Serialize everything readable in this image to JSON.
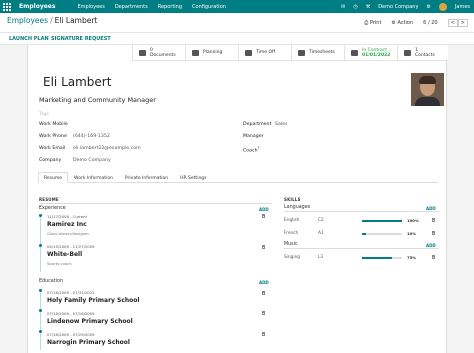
{
  "topbar": {
    "app_name": "Employees",
    "menu": [
      "Employees",
      "Departments",
      "Reporting",
      "Configuration"
    ],
    "company": "Demo Company",
    "user": "James"
  },
  "breadcrumb": {
    "parent": "Employees",
    "separator": "/",
    "current": "Eli Lambert"
  },
  "toolbar": {
    "print": "Print",
    "action": "Action",
    "pager": "6 / 20",
    "prev": "<",
    "next": ">"
  },
  "actions": {
    "launch_plan": "LAUNCH PLAN",
    "signature_request": "SIGNATURE REQUEST"
  },
  "smart_buttons": {
    "documents_count": "0",
    "documents_label": "Documents",
    "planning": "Planning",
    "time_off": "Time Off",
    "timesheets": "Timesheets",
    "contract_label": "In Contract ...",
    "contract_date": "01/01/2022",
    "contacts_count": "1",
    "contacts_label": "Contacts"
  },
  "employee": {
    "name": "Eli Lambert",
    "job_title": "Marketing and Community Manager",
    "tags_placeholder": "Tags",
    "work_mobile_label": "Work Mobile",
    "work_mobile": "",
    "work_phone_label": "Work Phone",
    "work_phone": "(644)-169-1352",
    "work_email_label": "Work Email",
    "work_email": "eli.lambert22@example.com",
    "company_label": "Company",
    "company": "Demo Company",
    "department_label": "Department",
    "department": "Sales",
    "manager_label": "Manager",
    "manager": "",
    "coach_label": "Coach",
    "coach_mark": "?"
  },
  "tabs": [
    "Resume",
    "Work Information",
    "Private Information",
    "HR Settings"
  ],
  "resume": {
    "section_label": "RESUME",
    "experience_label": "Experience",
    "add_label": "ADD",
    "experience": [
      {
        "dates": "11/17/2008 - Current",
        "title": "Ramirez Inc",
        "desc": "Glass blower/designer"
      },
      {
        "dates": "04/15/2009 - 11/27/2009",
        "title": "White-Bell",
        "desc": "Sports coach"
      }
    ],
    "education_label": "Education",
    "education": [
      {
        "dates": "07/16/2009 - 07/31/2012",
        "title": "Holy Family Primary School"
      },
      {
        "dates": "07/16/2009 - 07/16/2009",
        "title": "Lindenow Primary School"
      },
      {
        "dates": "07/16/2009 - 07/29/2009",
        "title": "Narrogin Primary School"
      }
    ]
  },
  "skills": {
    "section_label": "SKILLS",
    "add_label": "ADD",
    "groups": [
      {
        "name": "Languages",
        "items": [
          {
            "name": "English",
            "level": "C2",
            "percent_label": "100%",
            "progress": 1.0
          },
          {
            "name": "French",
            "level": "A1",
            "percent_label": "10%",
            "progress": 0.1
          }
        ]
      },
      {
        "name": "Music",
        "items": [
          {
            "name": "Singing",
            "level": "L3",
            "percent_label": "75%",
            "progress": 0.75
          }
        ]
      }
    ]
  },
  "colors": {
    "brand": "#017e84",
    "status_green": "#28a745"
  }
}
